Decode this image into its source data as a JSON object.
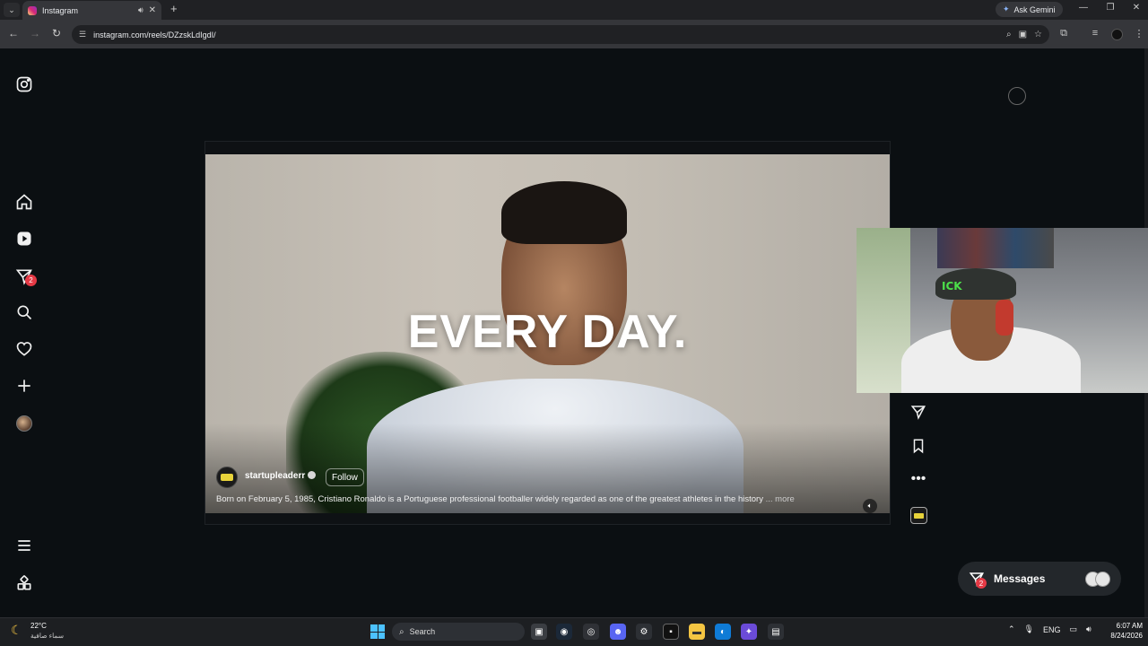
{
  "browser": {
    "tab_title": "Instagram",
    "url": "instagram.com/reels/DZzskLdIgdI/",
    "gemini_label": "Ask Gemini"
  },
  "sidebar": {
    "items": [
      {
        "name": "instagram-logo-icon"
      },
      {
        "name": "home-icon"
      },
      {
        "name": "reels-icon"
      },
      {
        "name": "messages-icon",
        "badge": "2"
      },
      {
        "name": "search-icon"
      },
      {
        "name": "notifications-icon"
      },
      {
        "name": "create-icon"
      },
      {
        "name": "profile-avatar"
      },
      {
        "name": "menu-icon"
      },
      {
        "name": "more-apps-icon"
      }
    ]
  },
  "reel": {
    "overlay_text": "EVERY DAY.",
    "author": "startupleaderr",
    "follow_label": "Follow",
    "caption": "Born on February 5, 1985, Cristiano Ronaldo is a Portuguese professional footballer widely regarded as one of the greatest athletes in the history",
    "more_label": "... more"
  },
  "webcam": {
    "cap_text": "ICK"
  },
  "messages_pill": {
    "label": "Messages",
    "badge": "2"
  },
  "taskbar": {
    "temperature": "22°C",
    "weather_desc": "سماء صافية",
    "search_label": "Search",
    "language": "ENG",
    "time": "6:07 AM",
    "date": "8/24/2026"
  }
}
